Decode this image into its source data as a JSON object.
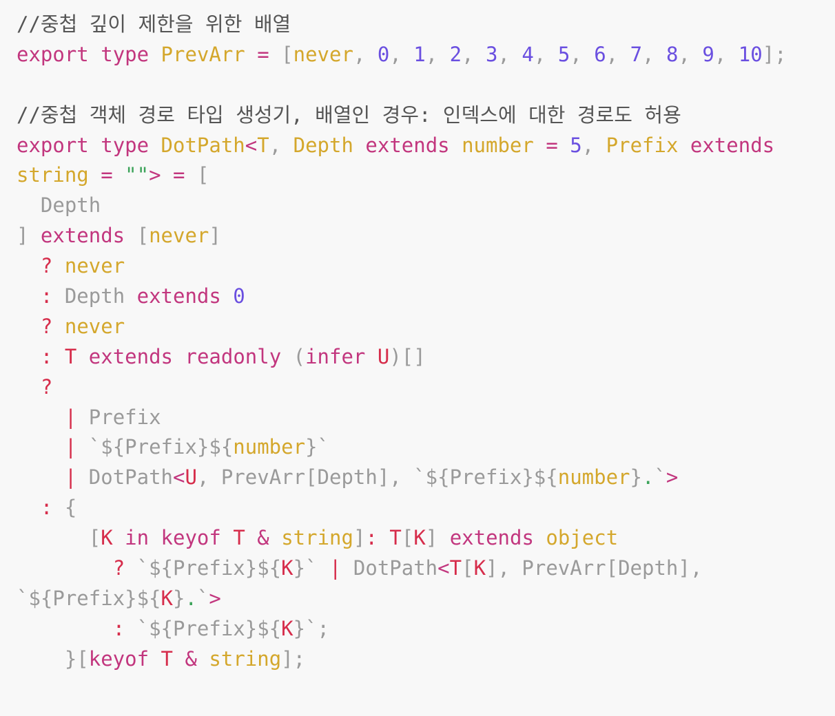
{
  "code": {
    "language": "typescript",
    "colors": {
      "background": "#f8f8f8",
      "comment": "#555555",
      "keyword": "#c2367e",
      "type": "#d4a72c",
      "number": "#6a4fe0",
      "punct": "#9a9a9a",
      "red": "#d62d4b",
      "green": "#3ca35a"
    },
    "lines": [
      [
        {
          "t": "//중첩 깊이 제한을 위한 배열",
          "c": "comment"
        }
      ],
      [
        {
          "t": "export",
          "c": "keyword"
        },
        {
          "t": " ",
          "c": "plain"
        },
        {
          "t": "type",
          "c": "keyword"
        },
        {
          "t": " ",
          "c": "plain"
        },
        {
          "t": "PrevArr",
          "c": "type"
        },
        {
          "t": " ",
          "c": "plain"
        },
        {
          "t": "=",
          "c": "op"
        },
        {
          "t": " [",
          "c": "punct"
        },
        {
          "t": "never",
          "c": "type"
        },
        {
          "t": ", ",
          "c": "punct"
        },
        {
          "t": "0",
          "c": "number"
        },
        {
          "t": ", ",
          "c": "punct"
        },
        {
          "t": "1",
          "c": "number"
        },
        {
          "t": ", ",
          "c": "punct"
        },
        {
          "t": "2",
          "c": "number"
        },
        {
          "t": ", ",
          "c": "punct"
        },
        {
          "t": "3",
          "c": "number"
        },
        {
          "t": ", ",
          "c": "punct"
        },
        {
          "t": "4",
          "c": "number"
        },
        {
          "t": ", ",
          "c": "punct"
        },
        {
          "t": "5",
          "c": "number"
        },
        {
          "t": ", ",
          "c": "punct"
        },
        {
          "t": "6",
          "c": "number"
        },
        {
          "t": ", ",
          "c": "punct"
        },
        {
          "t": "7",
          "c": "number"
        },
        {
          "t": ", ",
          "c": "punct"
        },
        {
          "t": "8",
          "c": "number"
        },
        {
          "t": ", ",
          "c": "punct"
        },
        {
          "t": "9",
          "c": "number"
        },
        {
          "t": ", ",
          "c": "punct"
        },
        {
          "t": "10",
          "c": "number"
        },
        {
          "t": "];",
          "c": "punct"
        }
      ],
      [],
      [
        {
          "t": "//중첩 객체 경로 타입 생성기, 배열인 경우: 인덱스에 대한 경로도 허용",
          "c": "comment"
        }
      ],
      [
        {
          "t": "export",
          "c": "keyword"
        },
        {
          "t": " ",
          "c": "plain"
        },
        {
          "t": "type",
          "c": "keyword"
        },
        {
          "t": " ",
          "c": "plain"
        },
        {
          "t": "DotPath",
          "c": "type"
        },
        {
          "t": "<",
          "c": "op"
        },
        {
          "t": "T",
          "c": "type"
        },
        {
          "t": ", ",
          "c": "punct"
        },
        {
          "t": "Depth",
          "c": "type"
        },
        {
          "t": " ",
          "c": "plain"
        },
        {
          "t": "extends",
          "c": "keyword"
        },
        {
          "t": " ",
          "c": "plain"
        },
        {
          "t": "number",
          "c": "type"
        },
        {
          "t": " ",
          "c": "plain"
        },
        {
          "t": "=",
          "c": "op"
        },
        {
          "t": " ",
          "c": "plain"
        },
        {
          "t": "5",
          "c": "number"
        },
        {
          "t": ", ",
          "c": "punct"
        },
        {
          "t": "Prefix",
          "c": "type"
        },
        {
          "t": " ",
          "c": "plain"
        },
        {
          "t": "extends",
          "c": "keyword"
        }
      ],
      [
        {
          "t": "string",
          "c": "type"
        },
        {
          "t": " ",
          "c": "plain"
        },
        {
          "t": "=",
          "c": "op"
        },
        {
          "t": " ",
          "c": "plain"
        },
        {
          "t": "\"\"",
          "c": "green"
        },
        {
          "t": ">",
          "c": "op"
        },
        {
          "t": " ",
          "c": "plain"
        },
        {
          "t": "=",
          "c": "op"
        },
        {
          "t": " [",
          "c": "punct"
        }
      ],
      [
        {
          "t": "  Depth",
          "c": "plain"
        }
      ],
      [
        {
          "t": "] ",
          "c": "punct"
        },
        {
          "t": "extends",
          "c": "keyword"
        },
        {
          "t": " [",
          "c": "punct"
        },
        {
          "t": "never",
          "c": "type"
        },
        {
          "t": "]",
          "c": "punct"
        }
      ],
      [
        {
          "t": "  ",
          "c": "plain"
        },
        {
          "t": "?",
          "c": "red"
        },
        {
          "t": " ",
          "c": "plain"
        },
        {
          "t": "never",
          "c": "type"
        }
      ],
      [
        {
          "t": "  ",
          "c": "plain"
        },
        {
          "t": ":",
          "c": "red"
        },
        {
          "t": " Depth ",
          "c": "plain"
        },
        {
          "t": "extends",
          "c": "keyword"
        },
        {
          "t": " ",
          "c": "plain"
        },
        {
          "t": "0",
          "c": "number"
        }
      ],
      [
        {
          "t": "  ",
          "c": "plain"
        },
        {
          "t": "?",
          "c": "red"
        },
        {
          "t": " ",
          "c": "plain"
        },
        {
          "t": "never",
          "c": "type"
        }
      ],
      [
        {
          "t": "  ",
          "c": "plain"
        },
        {
          "t": ":",
          "c": "red"
        },
        {
          "t": " ",
          "c": "plain"
        },
        {
          "t": "T",
          "c": "red"
        },
        {
          "t": " ",
          "c": "plain"
        },
        {
          "t": "extends",
          "c": "keyword"
        },
        {
          "t": " ",
          "c": "plain"
        },
        {
          "t": "readonly",
          "c": "keyword"
        },
        {
          "t": " (",
          "c": "punct"
        },
        {
          "t": "infer",
          "c": "keyword"
        },
        {
          "t": " ",
          "c": "plain"
        },
        {
          "t": "U",
          "c": "red"
        },
        {
          "t": ")[]",
          "c": "punct"
        }
      ],
      [
        {
          "t": "  ",
          "c": "plain"
        },
        {
          "t": "?",
          "c": "red"
        }
      ],
      [
        {
          "t": "    ",
          "c": "plain"
        },
        {
          "t": "|",
          "c": "red"
        },
        {
          "t": " Prefix",
          "c": "plain"
        }
      ],
      [
        {
          "t": "    ",
          "c": "plain"
        },
        {
          "t": "|",
          "c": "red"
        },
        {
          "t": " `${Prefix}${",
          "c": "plain"
        },
        {
          "t": "number",
          "c": "type"
        },
        {
          "t": "}`",
          "c": "plain"
        }
      ],
      [
        {
          "t": "    ",
          "c": "plain"
        },
        {
          "t": "|",
          "c": "red"
        },
        {
          "t": " DotPath",
          "c": "plain"
        },
        {
          "t": "<",
          "c": "op"
        },
        {
          "t": "U",
          "c": "red"
        },
        {
          "t": ", PrevArr[Depth], `${Prefix}${",
          "c": "plain"
        },
        {
          "t": "number",
          "c": "type"
        },
        {
          "t": "}",
          "c": "plain"
        },
        {
          "t": ".",
          "c": "green"
        },
        {
          "t": "`",
          "c": "plain"
        },
        {
          "t": ">",
          "c": "op"
        }
      ],
      [
        {
          "t": "  ",
          "c": "plain"
        },
        {
          "t": ":",
          "c": "red"
        },
        {
          "t": " {",
          "c": "punct"
        }
      ],
      [
        {
          "t": "      [",
          "c": "punct"
        },
        {
          "t": "K",
          "c": "red"
        },
        {
          "t": " ",
          "c": "plain"
        },
        {
          "t": "in",
          "c": "keyword"
        },
        {
          "t": " ",
          "c": "plain"
        },
        {
          "t": "keyof",
          "c": "keyword"
        },
        {
          "t": " ",
          "c": "plain"
        },
        {
          "t": "T",
          "c": "red"
        },
        {
          "t": " ",
          "c": "plain"
        },
        {
          "t": "&",
          "c": "op"
        },
        {
          "t": " ",
          "c": "plain"
        },
        {
          "t": "string",
          "c": "type"
        },
        {
          "t": "]",
          "c": "punct"
        },
        {
          "t": ":",
          "c": "red"
        },
        {
          "t": " ",
          "c": "plain"
        },
        {
          "t": "T",
          "c": "red"
        },
        {
          "t": "[",
          "c": "punct"
        },
        {
          "t": "K",
          "c": "red"
        },
        {
          "t": "] ",
          "c": "punct"
        },
        {
          "t": "extends",
          "c": "keyword"
        },
        {
          "t": " ",
          "c": "plain"
        },
        {
          "t": "object",
          "c": "type"
        }
      ],
      [
        {
          "t": "        ",
          "c": "plain"
        },
        {
          "t": "?",
          "c": "red"
        },
        {
          "t": " `${Prefix}${",
          "c": "plain"
        },
        {
          "t": "K",
          "c": "red"
        },
        {
          "t": "}` ",
          "c": "plain"
        },
        {
          "t": "|",
          "c": "red"
        },
        {
          "t": " DotPath",
          "c": "plain"
        },
        {
          "t": "<",
          "c": "op"
        },
        {
          "t": "T",
          "c": "red"
        },
        {
          "t": "[",
          "c": "punct"
        },
        {
          "t": "K",
          "c": "red"
        },
        {
          "t": "], PrevArr[Depth],",
          "c": "punct"
        }
      ],
      [
        {
          "t": "`${Prefix}${",
          "c": "plain"
        },
        {
          "t": "K",
          "c": "red"
        },
        {
          "t": "}",
          "c": "plain"
        },
        {
          "t": ".",
          "c": "green"
        },
        {
          "t": "`",
          "c": "plain"
        },
        {
          "t": ">",
          "c": "op"
        }
      ],
      [
        {
          "t": "        ",
          "c": "plain"
        },
        {
          "t": ":",
          "c": "red"
        },
        {
          "t": " `${Prefix}${",
          "c": "plain"
        },
        {
          "t": "K",
          "c": "red"
        },
        {
          "t": "}`;",
          "c": "plain"
        }
      ],
      [
        {
          "t": "    }[",
          "c": "punct"
        },
        {
          "t": "keyof",
          "c": "keyword"
        },
        {
          "t": " ",
          "c": "plain"
        },
        {
          "t": "T",
          "c": "red"
        },
        {
          "t": " ",
          "c": "plain"
        },
        {
          "t": "&",
          "c": "op"
        },
        {
          "t": " ",
          "c": "plain"
        },
        {
          "t": "string",
          "c": "type"
        },
        {
          "t": "];",
          "c": "punct"
        }
      ]
    ]
  }
}
